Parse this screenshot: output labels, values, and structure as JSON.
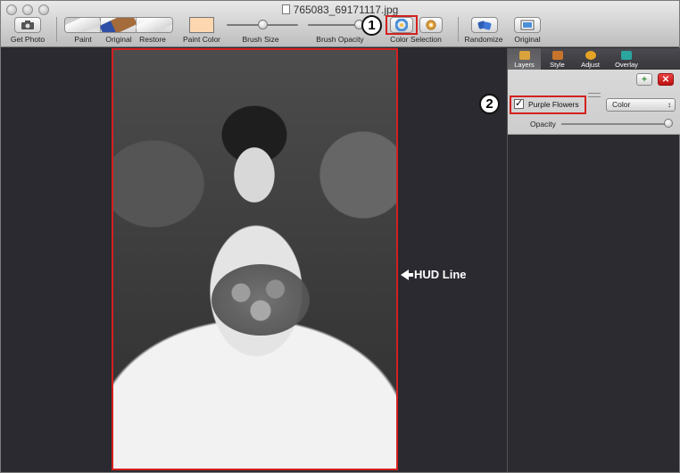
{
  "window": {
    "title": "765083_69171117.jpg"
  },
  "toolbar": {
    "get_photo": "Get Photo",
    "paint": "Paint",
    "original": "Original",
    "restore": "Restore",
    "paint_color": "Paint Color",
    "paint_color_value": "#fdd7b0",
    "brush_size": "Brush Size",
    "brush_size_value": 0.5,
    "brush_opacity": "Brush Opacity",
    "brush_opacity_value": 0.75,
    "color_selection": "Color Selection",
    "randomize": "Randomize",
    "original_view": "Original"
  },
  "callouts": {
    "one": "1",
    "two": "2"
  },
  "canvas": {
    "hud_label": "HUD Line"
  },
  "panel": {
    "tabs": [
      "Layers",
      "Style",
      "Adjust",
      "Overlay"
    ],
    "layer": {
      "name": "Purple Flowers",
      "checked": true,
      "blend_mode": "Color"
    },
    "opacity_label": "Opacity",
    "opacity_value": 1.0,
    "add_icon": "add-icon",
    "delete_icon": "delete-icon"
  },
  "colors": {
    "accent_red": "#d4201f",
    "add_green": "#2e8a2e"
  }
}
